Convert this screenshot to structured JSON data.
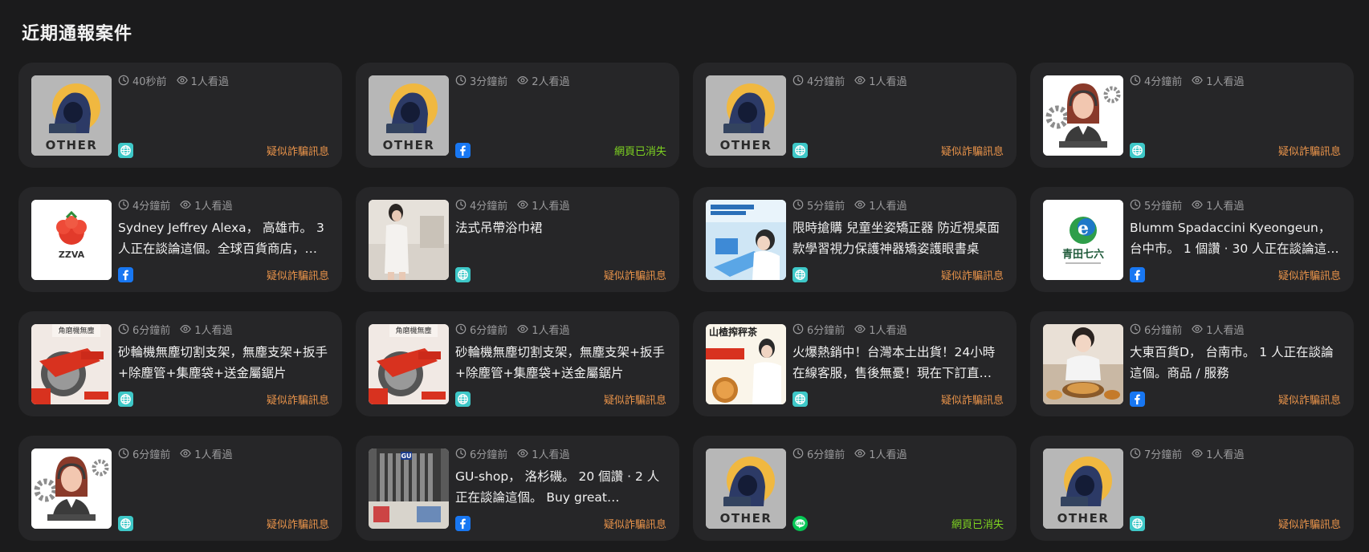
{
  "section_title": "近期通報案件",
  "colors": {
    "warn": "#e8934a",
    "gone": "#7ed321",
    "web": "#3ec8c8",
    "facebook": "#1877f2",
    "line": "#06c755"
  },
  "cards": [
    {
      "time": "40秒前",
      "views": "1人看過",
      "title": "",
      "source": "web-icon",
      "status": "疑似詐騙訊息",
      "status_type": "warn",
      "thumb": "other",
      "thumb_text": "OTHER"
    },
    {
      "time": "3分鐘前",
      "views": "2人看過",
      "title": "",
      "source": "facebook-icon",
      "status": "網頁已消失",
      "status_type": "gone",
      "thumb": "other",
      "thumb_text": "OTHER"
    },
    {
      "time": "4分鐘前",
      "views": "1人看過",
      "title": "",
      "source": "web-icon",
      "status": "疑似詐騙訊息",
      "status_type": "warn",
      "thumb": "other",
      "thumb_text": "OTHER"
    },
    {
      "time": "4分鐘前",
      "views": "1人看過",
      "title": "",
      "source": "web-icon",
      "status": "疑似詐騙訊息",
      "status_type": "warn",
      "thumb": "agent",
      "thumb_text": ""
    },
    {
      "time": "4分鐘前",
      "views": "1人看過",
      "title": "Sydney Jeffrey Alexa， 高雄市。 3 人正在談論這個。全球百貨商店，…",
      "source": "facebook-icon",
      "status": "疑似詐騙訊息",
      "status_type": "warn",
      "thumb": "zzva",
      "thumb_text": "ZZVA"
    },
    {
      "time": "4分鐘前",
      "views": "1人看過",
      "title": "法式吊帶浴巾裙",
      "source": "web-icon",
      "status": "疑似詐騙訊息",
      "status_type": "warn",
      "thumb": "photo-bath",
      "thumb_text": ""
    },
    {
      "time": "5分鐘前",
      "views": "1人看過",
      "title": "限時搶購 兒童坐姿矯正器 防近視桌面款學習視力保護神器矯姿護眼書桌",
      "source": "web-icon",
      "status": "疑似詐騙訊息",
      "status_type": "warn",
      "thumb": "photo-desk",
      "thumb_text": ""
    },
    {
      "time": "5分鐘前",
      "views": "1人看過",
      "title": "Blumm Spadaccini Kyeongeun， 台中市。 1 個讚 · 30 人正在談論這個…",
      "source": "facebook-icon",
      "status": "疑似詐騙訊息",
      "status_type": "warn",
      "thumb": "qingtian",
      "thumb_text": "青田七六"
    },
    {
      "time": "6分鐘前",
      "views": "1人看過",
      "title": "砂輪機無塵切割支架，無塵支架+扳手+除塵管+集塵袋+送金屬鋸片",
      "source": "web-icon",
      "status": "疑似詐騙訊息",
      "status_type": "warn",
      "thumb": "photo-saw",
      "thumb_text": ""
    },
    {
      "time": "6分鐘前",
      "views": "1人看過",
      "title": "砂輪機無塵切割支架，無塵支架+扳手+除塵管+集塵袋+送金屬鋸片",
      "source": "web-icon",
      "status": "疑似詐騙訊息",
      "status_type": "warn",
      "thumb": "photo-saw",
      "thumb_text": ""
    },
    {
      "time": "6分鐘前",
      "views": "1人看過",
      "title": "火爆熱銷中！台灣本土出貨！24小時在線客服，售後無憂！現在下訂直…",
      "source": "web-icon",
      "status": "疑似詐騙訊息",
      "status_type": "warn",
      "thumb": "photo-tea",
      "thumb_text": ""
    },
    {
      "time": "6分鐘前",
      "views": "1人看過",
      "title": "大東百貨D， 台南市。 1 人正在談論這個。商品 / 服務",
      "source": "facebook-icon",
      "status": "疑似詐騙訊息",
      "status_type": "warn",
      "thumb": "photo-food",
      "thumb_text": ""
    },
    {
      "time": "6分鐘前",
      "views": "1人看過",
      "title": "",
      "source": "web-icon",
      "status": "疑似詐騙訊息",
      "status_type": "warn",
      "thumb": "agent",
      "thumb_text": ""
    },
    {
      "time": "6分鐘前",
      "views": "1人看過",
      "title": "GU-shop， 洛杉磯。 20 個讚 · 2 人正在談論這個。 Buy great product…",
      "source": "facebook-icon",
      "status": "疑似詐騙訊息",
      "status_type": "warn",
      "thumb": "photo-store",
      "thumb_text": ""
    },
    {
      "time": "6分鐘前",
      "views": "1人看過",
      "title": "",
      "source": "line-icon",
      "status": "網頁已消失",
      "status_type": "gone",
      "thumb": "other",
      "thumb_text": "OTHER"
    },
    {
      "time": "7分鐘前",
      "views": "1人看過",
      "title": "",
      "source": "web-icon",
      "status": "疑似詐騙訊息",
      "status_type": "warn",
      "thumb": "other",
      "thumb_text": "OTHER"
    }
  ]
}
